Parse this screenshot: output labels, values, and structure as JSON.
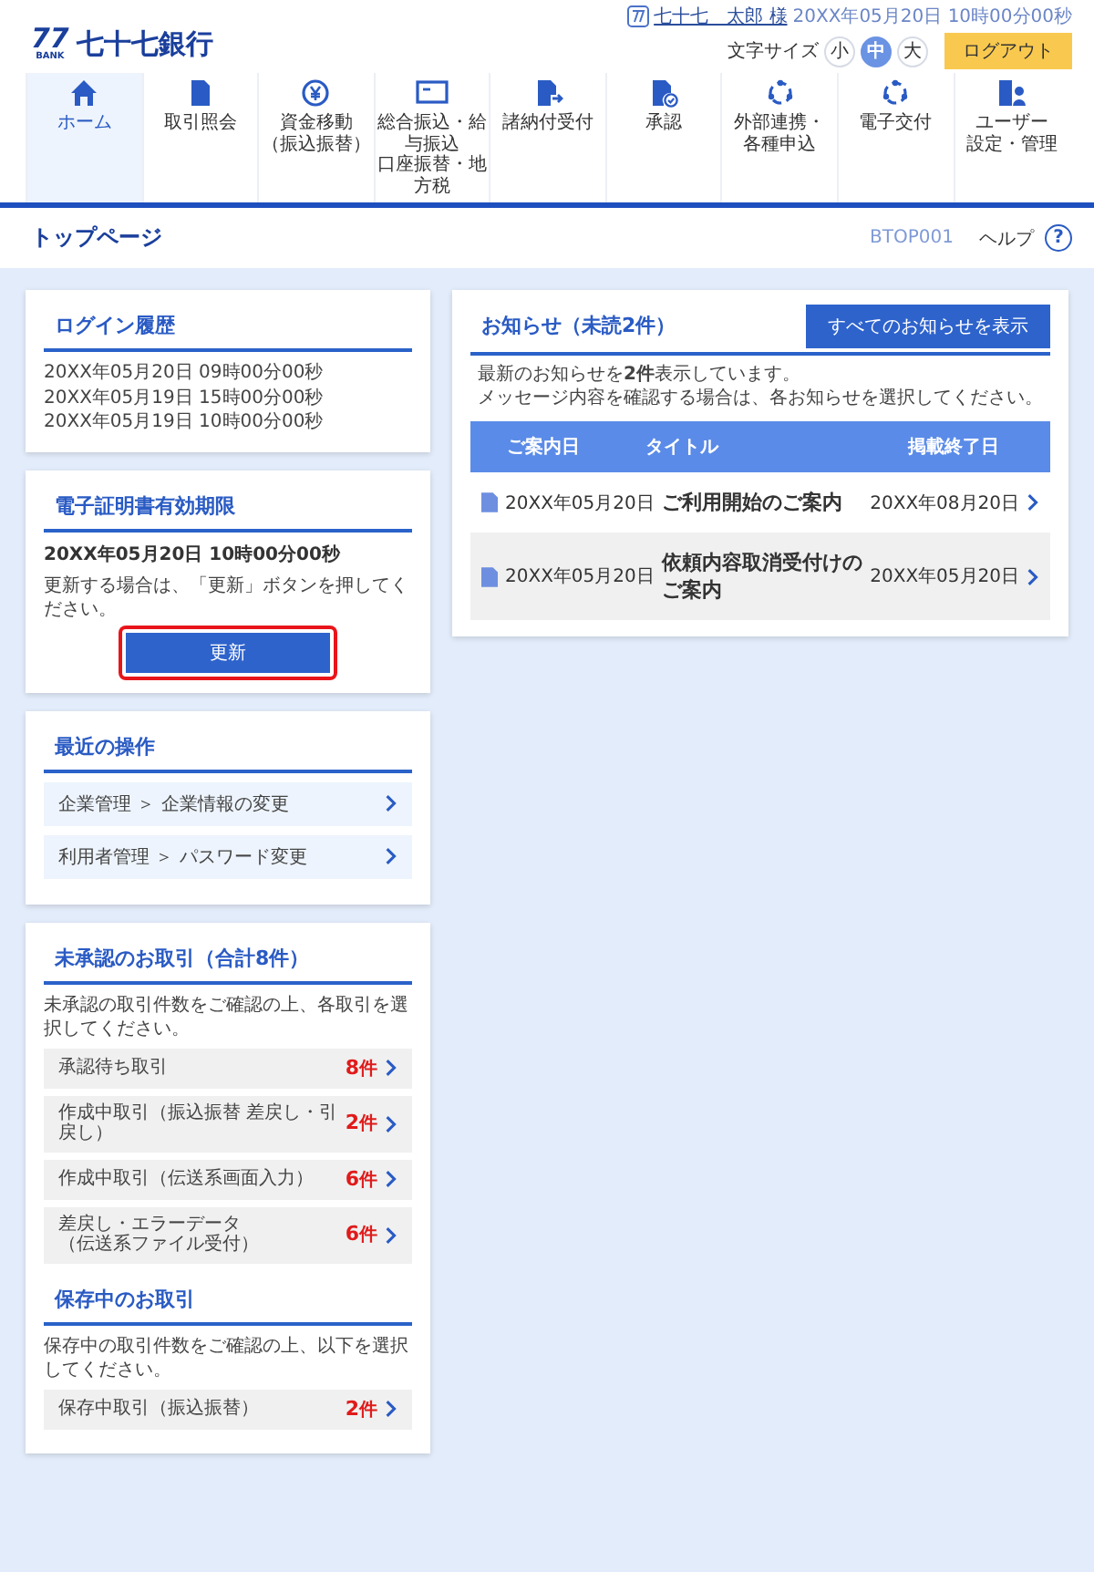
{
  "header": {
    "logo": {
      "mark": "77",
      "sub": "BANK",
      "name": "七十七銀行"
    },
    "user": "七十七　太郎 様",
    "datetime": "20XX年05月20日 10時00分00秒",
    "font_size_label": "文字サイズ",
    "font_sizes": [
      {
        "label": "小",
        "selected": false
      },
      {
        "label": "中",
        "selected": true
      },
      {
        "label": "大",
        "selected": false
      }
    ],
    "logout": "ログアウト"
  },
  "nav": [
    {
      "kind": "home",
      "label": "ホーム",
      "selected": true
    },
    {
      "kind": "doc",
      "label": "取引照会",
      "selected": false
    },
    {
      "kind": "yen",
      "label": [
        "資金移動",
        "（振込振替）"
      ],
      "selected": false
    },
    {
      "kind": "card",
      "label": [
        "総合振込・給与振込",
        "口座振替・地方税"
      ],
      "selected": false
    },
    {
      "kind": "docarrow",
      "label": "諸納付受付",
      "selected": false
    },
    {
      "kind": "doccheck",
      "label": "承認",
      "selected": false
    },
    {
      "kind": "ring",
      "label": [
        "外部連携・",
        "各種申込"
      ],
      "selected": false
    },
    {
      "kind": "ring",
      "label": "電子交付",
      "selected": false
    },
    {
      "kind": "user",
      "label": [
        "ユーザー",
        "設定・管理"
      ],
      "selected": false
    }
  ],
  "page": {
    "title": "トップページ",
    "code": "BTOP001",
    "help": "ヘルプ",
    "help_mark": "?"
  },
  "login_history": {
    "title": "ログイン履歴",
    "entries": [
      "20XX年05月20日 09時00分00秒",
      "20XX年05月19日 15時00分00秒",
      "20XX年05月19日 10時00分00秒"
    ]
  },
  "certificate": {
    "title": "電子証明書有効期限",
    "expiry": "20XX年05月20日 10時00分00秒",
    "note": "更新する場合は、「更新」ボタンを押してください。",
    "button": "更新",
    "highlighted": true
  },
  "recent": {
    "title": "最近の操作",
    "items": [
      "企業管理 ＞ 企業情報の変更",
      "利用者管理 ＞ パスワード変更"
    ]
  },
  "pending": {
    "title": "未承認のお取引（合計8件）",
    "note": "未承認の取引件数をご確認の上、各取引を選択してください。",
    "items": [
      {
        "label": "承認待ち取引",
        "count": "8",
        "unit": "件"
      },
      {
        "label": "作成中取引（振込振替 差戻し・引戻し）",
        "count": "2",
        "unit": "件"
      },
      {
        "label": "作成中取引（伝送系画面入力）",
        "count": "6",
        "unit": "件"
      },
      {
        "label": [
          "差戻し・エラーデータ",
          "（伝送系ファイル受付）"
        ],
        "count": "6",
        "unit": "件"
      }
    ]
  },
  "saved": {
    "title": "保存中のお取引",
    "note": "保存中の取引件数をご確認の上、以下を選択してください。",
    "items": [
      {
        "label": "保存中取引（振込振替）",
        "count": "2",
        "unit": "件"
      }
    ]
  },
  "notices": {
    "title": "お知らせ（未読2件）",
    "show_all": "すべてのお知らせを表示",
    "lines": [
      "最新のお知らせを**2件**表示しています。",
      "メッセージ内容を確認する場合は、各お知らせを選択してください。"
    ],
    "columns": [
      "ご案内日",
      "タイトル",
      "掲載終了日"
    ],
    "rows": [
      {
        "date": "20XX年05月20日",
        "title": "ご利用開始のご案内",
        "end": "20XX年08月20日"
      },
      {
        "date": "20XX年05月20日",
        "title": "依頼内容取消受付けのご案内",
        "end": "20XX年05月20日"
      }
    ]
  }
}
